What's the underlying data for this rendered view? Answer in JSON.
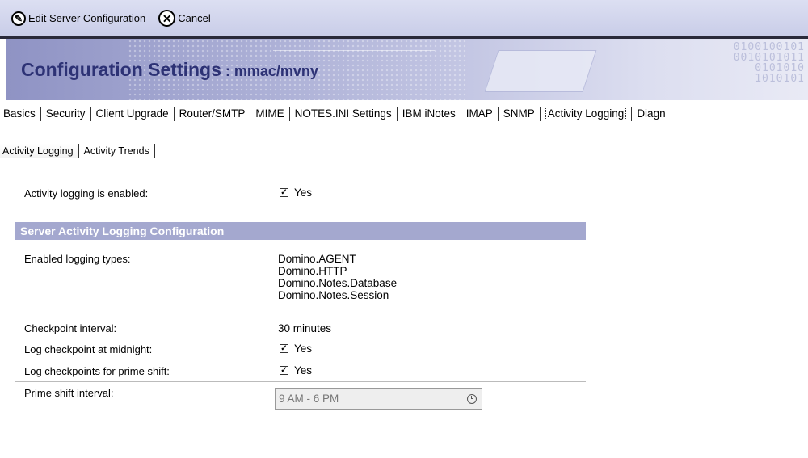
{
  "toolbar": {
    "edit_label": "Edit Server Configuration",
    "cancel_label": "Cancel"
  },
  "banner": {
    "title": "Configuration Settings",
    "separator": " : ",
    "server": "mmac/mvny",
    "binary": [
      "0100100101",
      "0010101011",
      "0101010",
      "1010101"
    ]
  },
  "main_tabs": [
    "Basics",
    "Security",
    "Client Upgrade",
    "Router/SMTP",
    "MIME",
    "NOTES.INI Settings",
    "IBM iNotes",
    "IMAP",
    "SNMP",
    "Activity Logging",
    "Diagn"
  ],
  "active_main_tab": "Activity Logging",
  "sub_tabs": [
    "Activity Logging",
    "Activity Trends"
  ],
  "form": {
    "logging_enabled_label": "Activity logging is enabled:",
    "logging_enabled_value": "Yes",
    "section_title": "Server Activity Logging Configuration",
    "types_label": "Enabled logging types:",
    "types": [
      "Domino.AGENT",
      "Domino.HTTP",
      "Domino.Notes.Database",
      "Domino.Notes.Session"
    ],
    "checkpoint_label": "Checkpoint interval:",
    "checkpoint_value": "30 minutes",
    "midnight_label": "Log checkpoint at midnight:",
    "midnight_value": "Yes",
    "prime_label": "Log checkpoints for prime shift:",
    "prime_value": "Yes",
    "interval_label": "Prime shift interval:",
    "interval_value": "9 AM - 6 PM"
  },
  "colors": {
    "section_header_bg": "#a4a8cf",
    "banner_title": "#2d3275",
    "toolbar_bg": "#c9cde8"
  }
}
